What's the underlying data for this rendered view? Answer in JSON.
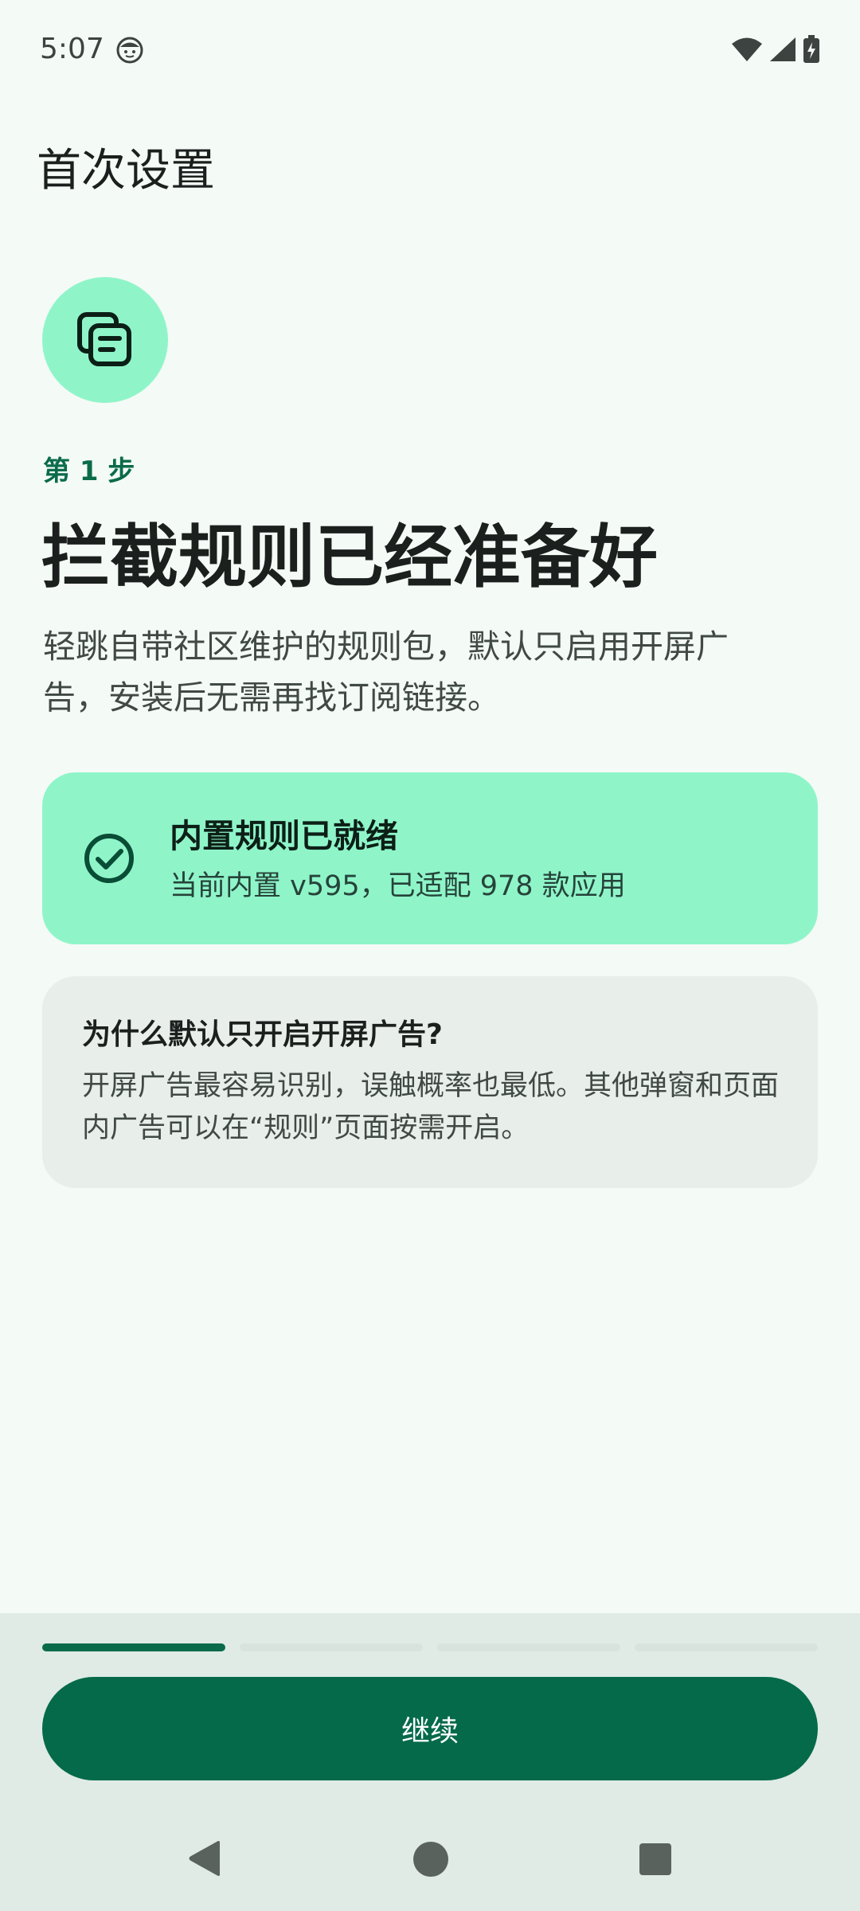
{
  "status_bar": {
    "time": "5:07"
  },
  "header": {
    "title": "首次设置"
  },
  "step": {
    "label": "第 1 步",
    "headline": "拦截规则已经准备好",
    "description": "轻跳自带社区维护的规则包，默认只启用开屏广告，安装后无需再找订阅链接。"
  },
  "ready_card": {
    "title": "内置规则已就绪",
    "subtitle": "当前内置 v595，已适配 978 款应用"
  },
  "why_card": {
    "title": "为什么默认只开启开屏广告?",
    "body": "开屏广告最容易识别，误触概率也最低。其他弹窗和页面内广告可以在“规则”页面按需开启。"
  },
  "progress": {
    "current_step": 1,
    "total_steps": 4
  },
  "footer": {
    "continue_label": "继续"
  },
  "colors": {
    "accent": "#046a4a",
    "mint": "#8ff5c9",
    "background": "#f4faf6"
  }
}
